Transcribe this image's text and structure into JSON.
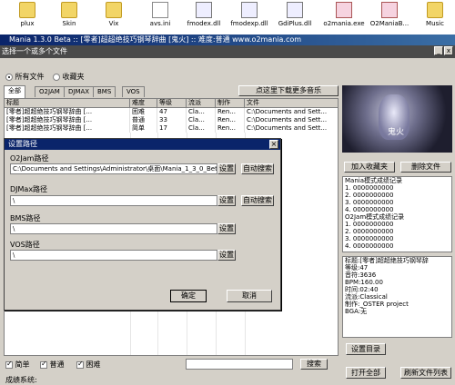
{
  "desktop_icons": [
    {
      "label": "plux",
      "type": "folder"
    },
    {
      "label": "Skin",
      "type": "folder"
    },
    {
      "label": "Vix",
      "type": "folder"
    },
    {
      "label": "avs.ini",
      "type": "file"
    },
    {
      "label": "fmodex.dll",
      "type": "dll"
    },
    {
      "label": "fmodexp.dll",
      "type": "dll"
    },
    {
      "label": "GdiPlus.dll",
      "type": "dll"
    },
    {
      "label": "o2mania.exe",
      "type": "exe"
    },
    {
      "label": "O2ManiaB...",
      "type": "exe"
    },
    {
      "label": "Music",
      "type": "folder"
    }
  ],
  "window": {
    "title": "Mania 1.3.0 Beta :: [零者]超超绝技巧钢琴辞曲 [鬼火] :: 难度:普通 www.o2mania.com",
    "subtitle": "选择一个或多个文件"
  },
  "filter": {
    "all_files": "所有文件",
    "favorites": "收藏夹"
  },
  "tabs": [
    "全部",
    "O2JAM",
    "DJMAX",
    "BMS",
    "VOS"
  ],
  "download_button": "点这里下载更多音乐",
  "table": {
    "headers": [
      "标题",
      "难度",
      "等级",
      "流派",
      "制作",
      "文件"
    ],
    "rows": [
      [
        "[零者]超超绝技巧钢琴辞曲 [...",
        "困难",
        "47",
        "Cla...",
        "Ren...",
        "C:\\Documents and Sett..."
      ],
      [
        "[零者]超超绝技巧钢琴辞曲 [...",
        "普通",
        "33",
        "Cla...",
        "Ren...",
        "C:\\Documents and Sett..."
      ],
      [
        "[零者]超超绝技巧钢琴辞曲 [...",
        "简单",
        "17",
        "Cla...",
        "Ren...",
        "C:\\Documents and Sett..."
      ]
    ]
  },
  "bottom": {
    "easy": "简单",
    "normal": "普通",
    "hard": "困难",
    "search_button": "搜索",
    "search_label": "成绩系统:"
  },
  "right": {
    "cover_title": "鬼火",
    "add_favorite": "加入收藏夹",
    "delete_file": "删除文件",
    "records": [
      "Mania模式成绩记录",
      "1. 0000000000",
      "2. 0000000000",
      "3. 0000000000",
      "4. 0000000000",
      "O2Jam模式成绩记录",
      "1. 0000000000",
      "2. 0000000000",
      "3. 0000000000",
      "4. 0000000000"
    ],
    "info": [
      "标题:[零者]超超绝技巧钢琴辞",
      "等级:47",
      "音符:3636",
      "BPM:160.00",
      "时间:02:40",
      "流派:Classical",
      "制作:_OSTER project",
      "BGA:无"
    ],
    "set_dir": "设置目录",
    "open_all": "打开全部",
    "refresh_list": "刷新文件列表"
  },
  "dialog": {
    "title": "设置路径",
    "o2jam_label": "O2Jam路径",
    "o2jam_value": "C:\\Documents and Settings\\Administrator\\桌面\\Mania_1_3_0_Beta\\",
    "djmax_label": "DJMax路径",
    "djmax_value": "\\",
    "bms_label": "BMS路径",
    "bms_value": "\\",
    "vos_label": "VOS路径",
    "vos_value": "\\",
    "set_btn": "设置",
    "auto_btn": "自动搜索",
    "ok": "确定",
    "cancel": "取消"
  }
}
